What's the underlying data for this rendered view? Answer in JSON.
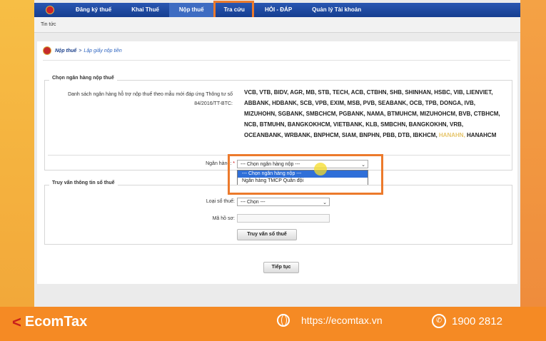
{
  "nav": {
    "items": [
      "Đăng ký thuế",
      "Khai Thuế",
      "Nộp thuế",
      "Tra cứu",
      "HỎI - ĐÁP",
      "Quản lý Tài khoản"
    ],
    "active_index": 2
  },
  "subnav": {
    "item": "Tin tức"
  },
  "breadcrumb": {
    "root": "Nộp thuế",
    "separator": ">",
    "current": "Lập giấy nộp tiền"
  },
  "bank_section": {
    "title": "Chọn ngân hàng nộp thuế",
    "list_label": "Danh sách ngân hàng hỗ trợ nộp thuế theo mẫu mới đáp ứng Thông tư số 84/2016/TT-BTC:",
    "banks_text_a": "VCB, VTB, BIDV, AGR, MB, STB, TECH, ACB, CTBHN, SHB, SHINHAN, HSBC, VIB, LIENVIET, ABBANK, HDBANK, SCB, VPB, EXIM, MSB, PVB, SEABANK, OCB, TPB, DONGA, IVB, MIZUHOHN, SGBANK, SMBCHCM, PGBANK, NAMA, BTMUHCM, MIZUHOHCM, BVB, CTBHCM, NCB, BTMUHN, BANGKOKHCM, VIETBANK, KLB, SMBCHN, BANGKOKHN, VRB, OCEANBANK, WRBANK, BNPHCM, SIAM, BNPHN, PBB, DTB, IBKHCM,",
    "banks_text_b": "HANAHN,",
    "banks_text_c": "HANAHCM",
    "bank_label": "Ngân hàng:",
    "required_mark": "*",
    "bank_select_value": "--- Chọn ngân hàng nộp ---",
    "bank_options": [
      "--- Chọn ngân hàng nộp ---",
      "Ngân hàng TMCP Quân đội"
    ],
    "selected_option_index": 0
  },
  "lookup_section": {
    "title": "Truy vấn thông tin sổ thuế",
    "type_label": "Loại sổ thuế:",
    "type_value": "--- Chọn ---",
    "code_label": "Mã hồ sơ:",
    "code_value": "",
    "lookup_button": "Truy vấn sổ thuế"
  },
  "continue_button": "Tiếp tục",
  "footer": {
    "brand": "EcomTax",
    "website": "https://ecomtax.vn",
    "phone": "1900 2812"
  },
  "colors": {
    "nav_blue": "#1e4aa3",
    "highlight_orange": "#ec7a2c",
    "footer_orange": "#f58a24",
    "selected_option_blue": "#2f6fd8"
  },
  "icons": [
    "nav-logo-icon",
    "seal-icon",
    "chevron-down-icon",
    "cursor-highlight-icon",
    "ecomtax-logo-icon",
    "globe-icon",
    "phone-icon"
  ]
}
